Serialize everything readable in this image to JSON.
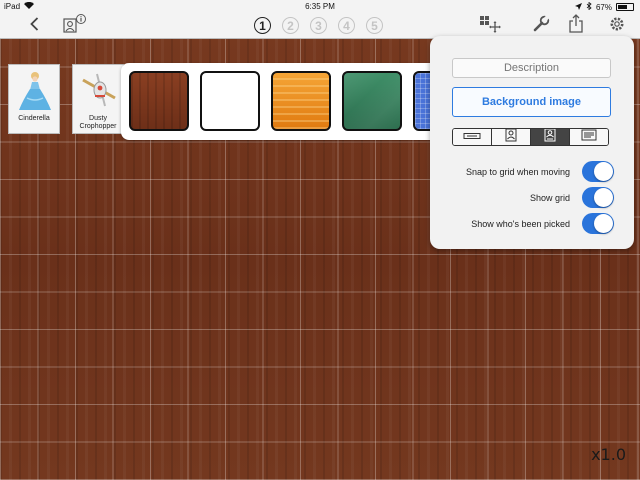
{
  "status_bar": {
    "device": "iPad",
    "time": "6:35 PM",
    "battery": "67%",
    "battery_level": 0.67
  },
  "toolbar": {
    "back_icon": "chevron-left-icon",
    "info_icon": "person-card-info-icon",
    "pages": [
      "1",
      "2",
      "3",
      "4",
      "5"
    ],
    "active_page": "1",
    "grid_settings_icon": "grid-move-icon",
    "wrench_icon": "wrench-icon",
    "share_icon": "share-icon",
    "settings_icon": "gear-icon"
  },
  "people": [
    {
      "name": "Cinderella"
    },
    {
      "name": "Dusty Crophopper"
    }
  ],
  "background_options": [
    {
      "name": "dark-wood",
      "colors": [
        "#8a3f22",
        "#6d2f18"
      ]
    },
    {
      "name": "white",
      "colors": [
        "#ffffff",
        "#ffffff"
      ]
    },
    {
      "name": "light-wood",
      "colors": [
        "#f5a536",
        "#e07a10"
      ]
    },
    {
      "name": "green-chalkboard",
      "colors": [
        "#3f8f68",
        "#2d6e4f"
      ]
    },
    {
      "name": "blue-grid",
      "colors": [
        "#4a73d8",
        "#2f56c2"
      ]
    }
  ],
  "settings": {
    "description_placeholder": "Description",
    "background_button": "Background image",
    "display_modes": [
      "name-only",
      "photo",
      "photo-name",
      "details"
    ],
    "selected_display_mode": 2,
    "toggles": [
      {
        "label": "Snap to grid when moving",
        "on": true
      },
      {
        "label": "Show grid",
        "on": true
      },
      {
        "label": "Show who's been picked",
        "on": true
      }
    ]
  },
  "zoom": "x1.0",
  "colors": {
    "accent": "#2a74db",
    "board_wood": "#6b3520"
  }
}
